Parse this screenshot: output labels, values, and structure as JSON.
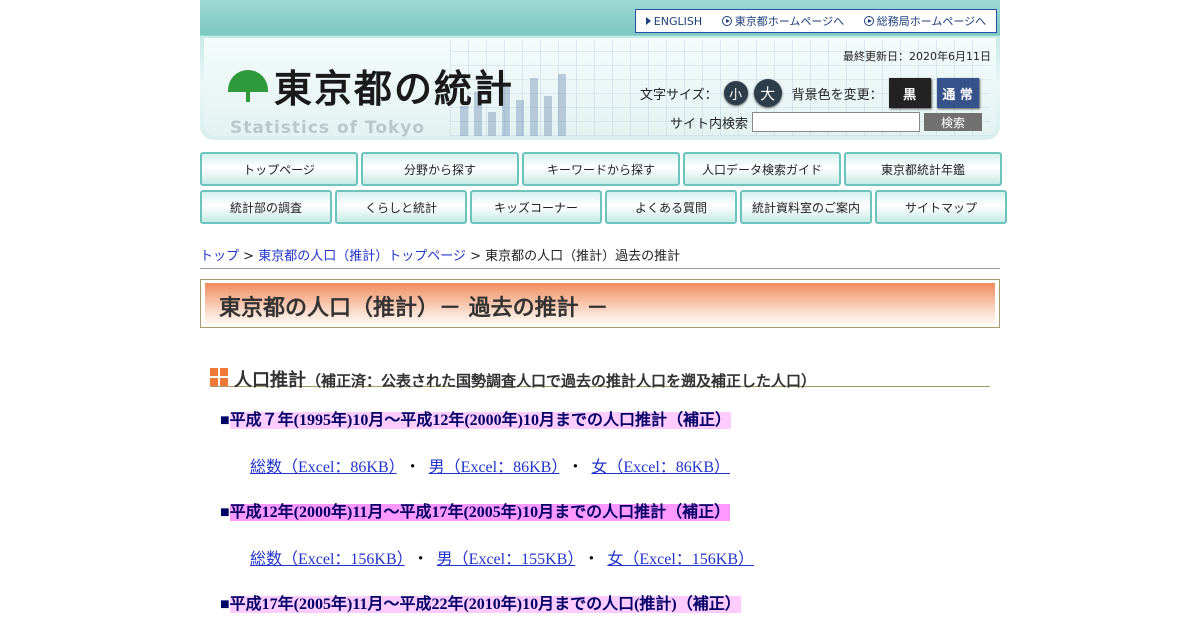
{
  "header": {
    "top_links": [
      {
        "label": "ENGLISH",
        "icon": "triangle-right-icon"
      },
      {
        "label": "東京都ホームページへ",
        "icon": "circle-play-icon"
      },
      {
        "label": "総務局ホームページへ",
        "icon": "circle-play-icon"
      }
    ],
    "logo_text": "東京都の統計",
    "logo_sub": "Statistics of Tokyo",
    "updated": "最終更新日：2020年6月11日",
    "font_size_label": "文字サイズ：",
    "font_small": "小",
    "font_large": "大",
    "bg_label": "背景色を変更：",
    "bg_black": "黒",
    "bg_normal": "通 常",
    "search_label": "サイト内検索",
    "search_value": "",
    "search_button": "検索"
  },
  "nav": {
    "row1": [
      "トップページ",
      "分野から探す",
      "キーワードから探す",
      "人口データ検索ガイド",
      "東京都統計年鑑"
    ],
    "row2": [
      "統計部の調査",
      "くらしと統計",
      "キッズコーナー",
      "よくある質問",
      "統計資料室のご案内",
      "サイトマップ"
    ]
  },
  "breadcrumb": {
    "items": [
      "トップ",
      "東京都の人口（推計）トップページ"
    ],
    "separator": " > ",
    "current": "東京都の人口（推計）過去の推計"
  },
  "page_title": "東京都の人口（推計）－ 過去の推計 －",
  "section": {
    "title": "人口推計",
    "subtitle": "（補正済：公表された国勢調査人口で過去の推計人口を遡及補正した人口）"
  },
  "periods": [
    {
      "label": "平成７年(1995年)10月～平成12年(2000年)10月までの人口推計（補正）",
      "files": [
        "総数（Excel：86KB）",
        "男（Excel：86KB）",
        "女（Excel：86KB）"
      ]
    },
    {
      "label": "平成12年(2000年)11月～平成17年(2005年)10月までの人口推計（補正）",
      "files": [
        "総数（Excel：156KB）",
        "男（Excel：155KB）",
        "女（Excel：156KB）"
      ]
    },
    {
      "label": "平成17年(2005年)11月～平成22年(2010年)10月までの人口(推計)（補正）",
      "files": []
    }
  ],
  "bullet": "■",
  "file_separator": "・",
  "colors": {
    "accent_teal": "#6cc4bd",
    "title_orange": "#f08b5e",
    "highlight_pink": "#ff99ff",
    "link_blue": "#2233cc"
  }
}
